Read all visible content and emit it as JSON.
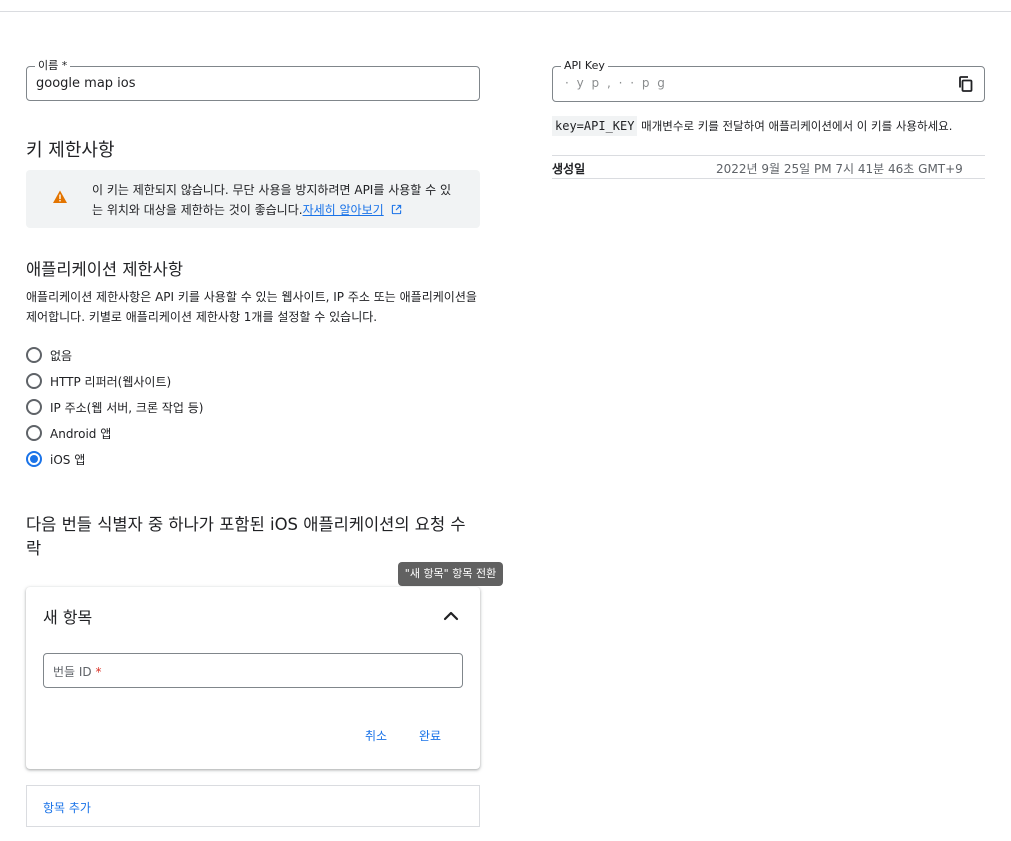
{
  "form": {
    "name_label": "이름 *",
    "name_value": "google map ios"
  },
  "key_restrictions": {
    "heading": "키 제한사항",
    "warning_text": "이 키는 제한되지 않습니다. 무단 사용을 방지하려면 API를 사용할 수 있는 위치와 대상을 제한하는 것이 좋습니다.",
    "learn_more": "자세히 알아보기",
    "warning_color": "#e37400"
  },
  "app_restrictions": {
    "heading": "애플리케이션 제한사항",
    "description": "애플리케이션 제한사항은 API 키를 사용할 수 있는 웹사이트, IP 주소 또는 애플리케이션을 제어합니다. 키별로 애플리케이션 제한사항 1개를 설정할 수 있습니다.",
    "options": [
      {
        "label": "없음",
        "checked": false
      },
      {
        "label": "HTTP 리퍼러(웹사이트)",
        "checked": false
      },
      {
        "label": "IP 주소(웹 서버, 크론 작업 등)",
        "checked": false
      },
      {
        "label": "Android 앱",
        "checked": false
      },
      {
        "label": "iOS 앱",
        "checked": true
      }
    ]
  },
  "bundle": {
    "heading": "다음 번들 식별자 중 하나가 포함된 iOS 애플리케이션의 요청 수락",
    "tooltip": "\"새 항목\" 항목 전환",
    "card_title": "새 항목",
    "bundle_placeholder": "번들 ID",
    "required_mark": "*",
    "cancel_label": "취소",
    "done_label": "완료",
    "add_item_label": "항목 추가"
  },
  "api_key": {
    "label": "API Key",
    "masked_value": "·    y         p                                    ,   · · p g",
    "hint_code": "key=API_KEY",
    "hint_text": "매개변수로 키를 전달하여 애플리케이션에서 이 키를 사용하세요.",
    "created_label": "생성일",
    "created_value": "2022년 9월 25일 PM 7시 41분 46초 GMT+9"
  },
  "colors": {
    "accent": "#1a73e8",
    "required": "#d93025"
  }
}
